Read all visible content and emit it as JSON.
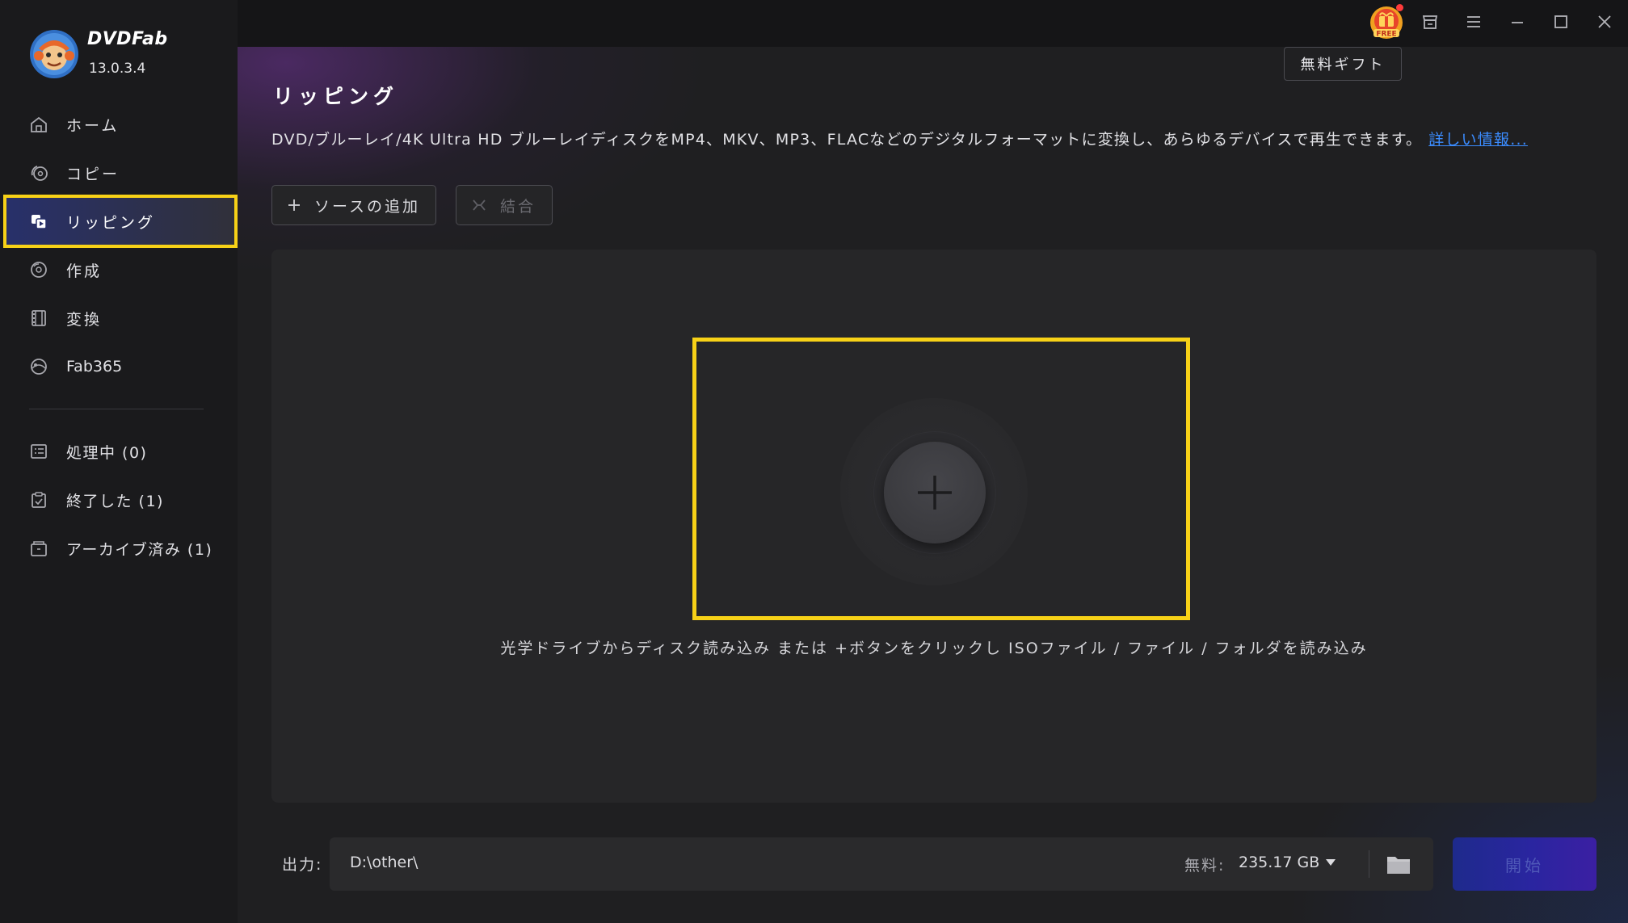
{
  "app": {
    "brand": "DVDFab",
    "version": "13.0.3.4"
  },
  "sidebar": {
    "items": [
      {
        "label": "ホーム",
        "icon": "home-icon"
      },
      {
        "label": "コピー",
        "icon": "copy-disc-icon"
      },
      {
        "label": "リッピング",
        "icon": "ripper-icon",
        "active": true
      },
      {
        "label": "作成",
        "icon": "creator-disc-icon"
      },
      {
        "label": "変換",
        "icon": "film-icon"
      },
      {
        "label": "Fab365",
        "icon": "fab365-icon"
      }
    ],
    "queue": [
      {
        "label": "処理中 (0)",
        "icon": "task-list-icon"
      },
      {
        "label": "終了した (1)",
        "icon": "clipboard-check-icon"
      },
      {
        "label": "アーカイブ済み (1)",
        "icon": "archive-box-icon"
      }
    ]
  },
  "titlebar": {
    "free_badge": "FREE",
    "gift_tooltip": "無料ギフト",
    "icons": [
      "free-gift-icon",
      "shop-icon",
      "menu-icon",
      "minimize-icon",
      "maximize-icon",
      "close-icon"
    ]
  },
  "page": {
    "title": "リッピング",
    "description": "DVD/ブルーレイ/4K Ultra HD ブルーレイディスクをMP4、MKV、MP3、FLACなどのデジタルフォーマットに変換し、あらゆるデバイスで再生できます。",
    "more_link": "詳しい情報..."
  },
  "toolbar": {
    "add_source": "ソースの追加",
    "merge": "結合"
  },
  "drop": {
    "hint": "光学ドライブからディスク読み込み または +ボタンをクリックし ISOファイル / ファイル / フォルダを読み込み"
  },
  "output": {
    "label": "出力:",
    "path": "D:\\other\\",
    "free_label": "無料:",
    "free_size": "235.17 GB",
    "start": "開始"
  },
  "colors": {
    "highlight": "#f7d117",
    "link": "#3b8cff",
    "start_button": "#2a25a0",
    "sidebar_active": "#28306a"
  }
}
